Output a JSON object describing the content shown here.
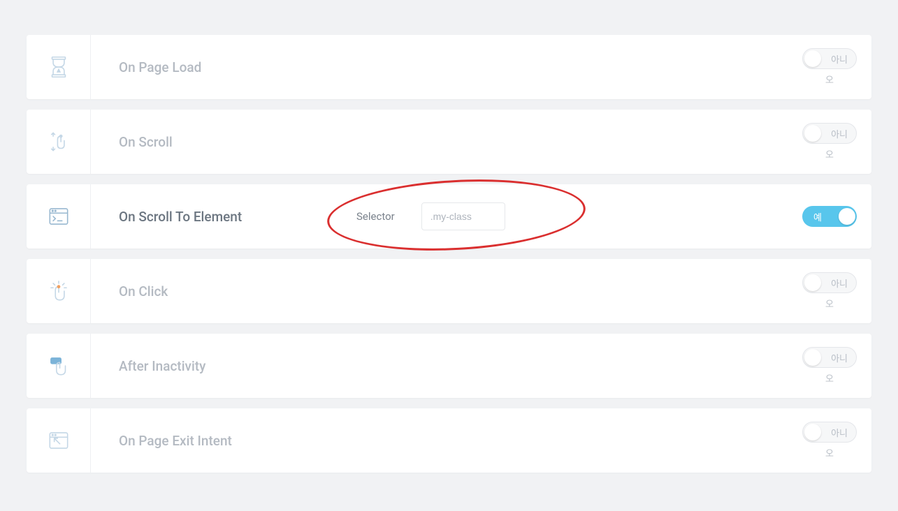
{
  "toggle": {
    "on_label": "예",
    "off_label": "아니",
    "off_sub": "오"
  },
  "rows": [
    {
      "title": "On Page Load",
      "enabled": false
    },
    {
      "title": "On Scroll",
      "enabled": false
    },
    {
      "title": "On Scroll To Element",
      "enabled": true,
      "selector_label": "Selector",
      "selector_placeholder": ".my-class"
    },
    {
      "title": "On Click",
      "enabled": false
    },
    {
      "title": "After Inactivity",
      "enabled": false
    },
    {
      "title": "On Page Exit Intent",
      "enabled": false
    }
  ]
}
